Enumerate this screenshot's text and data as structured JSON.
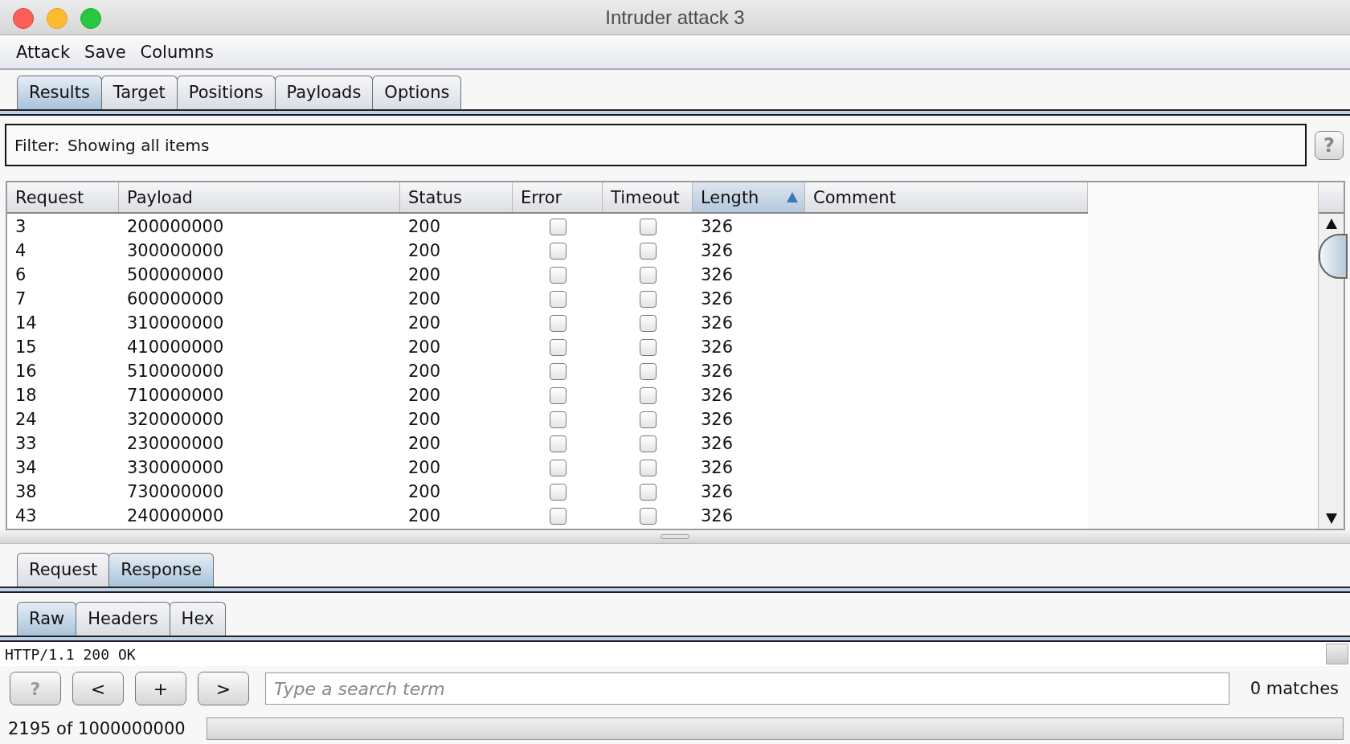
{
  "window": {
    "title": "Intruder attack 3"
  },
  "menu": [
    "Attack",
    "Save",
    "Columns"
  ],
  "tabs": [
    {
      "label": "Results",
      "selected": true
    },
    {
      "label": "Target",
      "selected": false
    },
    {
      "label": "Positions",
      "selected": false
    },
    {
      "label": "Payloads",
      "selected": false
    },
    {
      "label": "Options",
      "selected": false
    }
  ],
  "filter": {
    "label": "Filter:",
    "value": "Showing all items",
    "help": "?"
  },
  "table": {
    "columns": [
      {
        "label": "Request",
        "kind": "text",
        "sorted": false
      },
      {
        "label": "Payload",
        "kind": "text",
        "sorted": false
      },
      {
        "label": "Status",
        "kind": "text",
        "sorted": false
      },
      {
        "label": "Error",
        "kind": "check",
        "sorted": false
      },
      {
        "label": "Timeout",
        "kind": "check",
        "sorted": false
      },
      {
        "label": "Length",
        "kind": "text",
        "sorted": true
      },
      {
        "label": "Comment",
        "kind": "text",
        "sorted": false
      }
    ],
    "rows": [
      {
        "request": "3",
        "payload": "200000000",
        "status": "200",
        "error": false,
        "timeout": false,
        "length": "326"
      },
      {
        "request": "4",
        "payload": "300000000",
        "status": "200",
        "error": false,
        "timeout": false,
        "length": "326"
      },
      {
        "request": "6",
        "payload": "500000000",
        "status": "200",
        "error": false,
        "timeout": false,
        "length": "326"
      },
      {
        "request": "7",
        "payload": "600000000",
        "status": "200",
        "error": false,
        "timeout": false,
        "length": "326"
      },
      {
        "request": "14",
        "payload": "310000000",
        "status": "200",
        "error": false,
        "timeout": false,
        "length": "326"
      },
      {
        "request": "15",
        "payload": "410000000",
        "status": "200",
        "error": false,
        "timeout": false,
        "length": "326"
      },
      {
        "request": "16",
        "payload": "510000000",
        "status": "200",
        "error": false,
        "timeout": false,
        "length": "326"
      },
      {
        "request": "18",
        "payload": "710000000",
        "status": "200",
        "error": false,
        "timeout": false,
        "length": "326"
      },
      {
        "request": "24",
        "payload": "320000000",
        "status": "200",
        "error": false,
        "timeout": false,
        "length": "326"
      },
      {
        "request": "33",
        "payload": "230000000",
        "status": "200",
        "error": false,
        "timeout": false,
        "length": "326"
      },
      {
        "request": "34",
        "payload": "330000000",
        "status": "200",
        "error": false,
        "timeout": false,
        "length": "326"
      },
      {
        "request": "38",
        "payload": "730000000",
        "status": "200",
        "error": false,
        "timeout": false,
        "length": "326"
      },
      {
        "request": "43",
        "payload": "240000000",
        "status": "200",
        "error": false,
        "timeout": false,
        "length": "326"
      }
    ]
  },
  "message_tabs": [
    {
      "label": "Request",
      "selected": false
    },
    {
      "label": "Response",
      "selected": true
    }
  ],
  "view_tabs": [
    {
      "label": "Raw",
      "selected": true
    },
    {
      "label": "Headers",
      "selected": false
    },
    {
      "label": "Hex",
      "selected": false
    }
  ],
  "response_text": "HTTP/1.1 200 OK",
  "search": {
    "buttons": [
      "?",
      "<",
      "+",
      ">"
    ],
    "placeholder": "Type a search term",
    "matches": "0 matches"
  },
  "status_bar": {
    "progress_text": "2195 of 1000000000",
    "level": 0
  }
}
